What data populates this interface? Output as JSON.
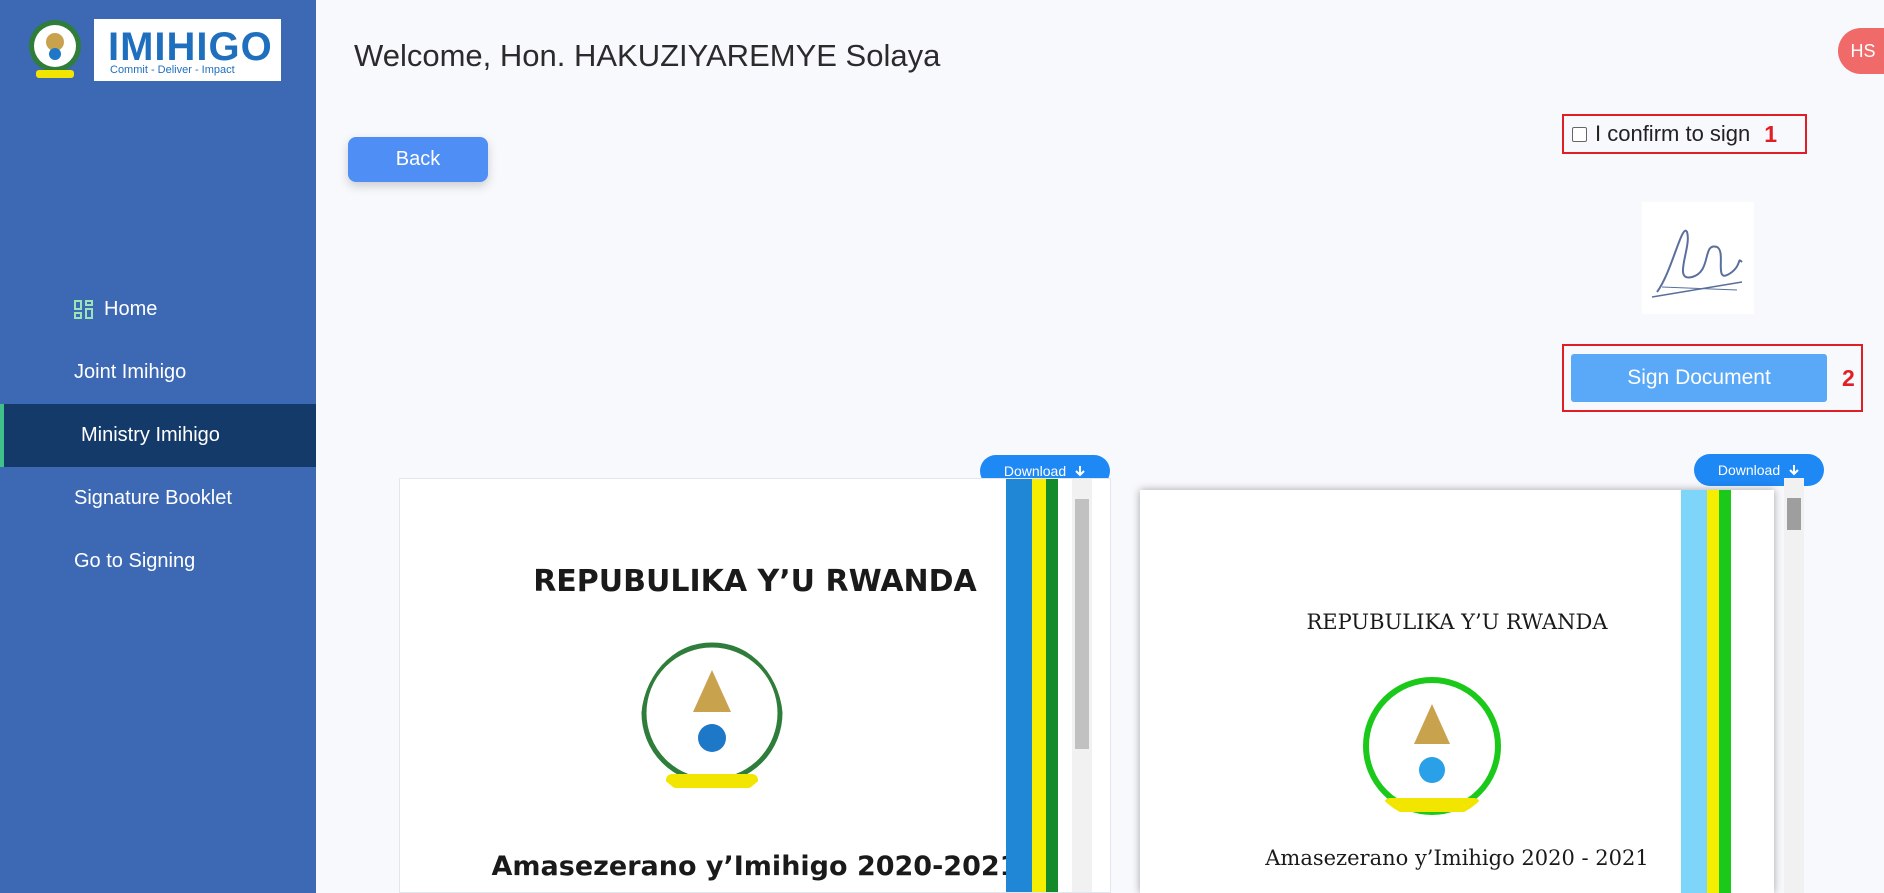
{
  "sidebar": {
    "brand": {
      "name": "IMIHIGO",
      "tagline": "Commit - Deliver - Impact"
    },
    "items": [
      {
        "label": "Home",
        "icon": "dashboard-icon"
      },
      {
        "label": "Joint Imihigo"
      },
      {
        "label": "Ministry Imihigo",
        "active": true
      },
      {
        "label": "Signature Booklet"
      },
      {
        "label": "Go to Signing"
      }
    ]
  },
  "header": {
    "title": "Welcome,  Hon.  HAKUZIYAREMYE Solaya",
    "avatar_initials": "HS"
  },
  "actions": {
    "back_label": "Back",
    "confirm_label": "I confirm to sign",
    "confirm_checked": false,
    "marker_1": "1",
    "sign_label": "Sign Document",
    "marker_2": "2"
  },
  "documents": [
    {
      "download_label": "Download",
      "heading": "REPUBULIKA Y’U RWANDA",
      "subtitle": "Amasezerano y’Imihigo 2020-2021"
    },
    {
      "download_label": "Download",
      "heading": "REPUBULIKA Y’U RWANDA",
      "subtitle": "Amasezerano y’Imihigo 2020 - 2021"
    }
  ],
  "colors": {
    "sidebar": "#3d68b4",
    "active_nav": "#143a6a",
    "back_button": "#4f8ef4",
    "sign_button": "#5aa9f8",
    "download_button": "#1e88f5",
    "annotation": "#e01e26",
    "avatar": "#f06a6a"
  }
}
